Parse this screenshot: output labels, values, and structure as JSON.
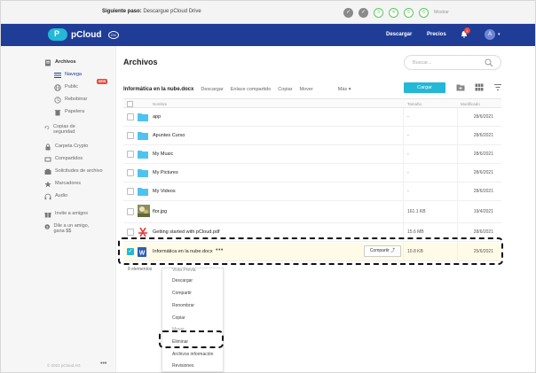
{
  "progress": {
    "step_label": "Siguiente paso:",
    "step_text": "Descargue pCloud Drive",
    "steps": [
      "✓",
      "✓",
      "3",
      "4",
      "5",
      "6"
    ],
    "later": "Mostrar"
  },
  "header": {
    "brand": "pCloud",
    "lang": "EN",
    "nav": [
      "Descargar",
      "Precios"
    ],
    "notifications": "1",
    "avatar": "A"
  },
  "sidebar": {
    "items": [
      {
        "label": "Archivos",
        "icon": "folder-icon"
      },
      {
        "label": "Navega",
        "icon": "list-icon"
      },
      {
        "label": "Public",
        "icon": "globe-icon"
      },
      {
        "label": "Rebobinar",
        "icon": "rewind-icon"
      },
      {
        "label": "Papelera",
        "icon": "trash-icon"
      },
      {
        "label": "Copias de seguridad",
        "icon": "backup-icon"
      },
      {
        "label": "Carpeta Crypto",
        "icon": "lock-icon"
      },
      {
        "label": "Compartidos",
        "icon": "share-icon"
      },
      {
        "label": "Solicitudes de archivo",
        "icon": "request-icon"
      },
      {
        "label": "Marcadores",
        "icon": "star-icon"
      },
      {
        "label": "Audio",
        "icon": "headphones-icon"
      },
      {
        "label": "Invite a amigos",
        "icon": "gift-icon"
      },
      {
        "label": "Dile a un amigo, gana $$",
        "icon": "dollar-icon"
      }
    ],
    "new_badge": "NEW",
    "copyright": "© 2021 pCloud AG",
    "more": "•••"
  },
  "main": {
    "title": "Archivos",
    "search_placeholder": "Buscar...",
    "selected_file": "Informática en la nube.docx",
    "actions": [
      "Descargar",
      "Enlace compartido",
      "Copiar",
      "Mover"
    ],
    "more": "Más",
    "upload": "Cargar",
    "columns": [
      "Nombre",
      "Tamaño",
      "Modificado"
    ],
    "rows": [
      {
        "name": "app",
        "type": "folder",
        "size": "-",
        "date": "28/6/2021"
      },
      {
        "name": "Apuntes Curso",
        "type": "folder",
        "size": "-",
        "date": "28/6/2021"
      },
      {
        "name": "My Music",
        "type": "folder",
        "size": "-",
        "date": "28/6/2021"
      },
      {
        "name": "My Pictures",
        "type": "folder",
        "size": "-",
        "date": "28/6/2021"
      },
      {
        "name": "My Videos",
        "type": "folder",
        "size": "-",
        "date": "28/6/2021"
      },
      {
        "name": "flor.jpg",
        "type": "image",
        "size": "161.1 KB",
        "date": "19/4/2021"
      },
      {
        "name": "Getting started with pCloud.pdf",
        "type": "pdf",
        "size": "15.6 MB",
        "date": "28/6/2021"
      },
      {
        "name": "Informática en la nube.docx",
        "type": "word",
        "size": "10.8 KB",
        "date": "25/6/2021",
        "share": "Compartir"
      }
    ],
    "count": "8 elementos"
  },
  "context_menu": {
    "items": [
      "Vista Previa",
      "Descargar",
      "Compartir",
      "Renombrar",
      "Copiar",
      "Mover",
      "Eliminar",
      "Archivos información",
      "Revisiones"
    ]
  },
  "colors": {
    "brand": "#1f3c96",
    "accent": "#23b8d6",
    "badge": "#e94b3c"
  }
}
